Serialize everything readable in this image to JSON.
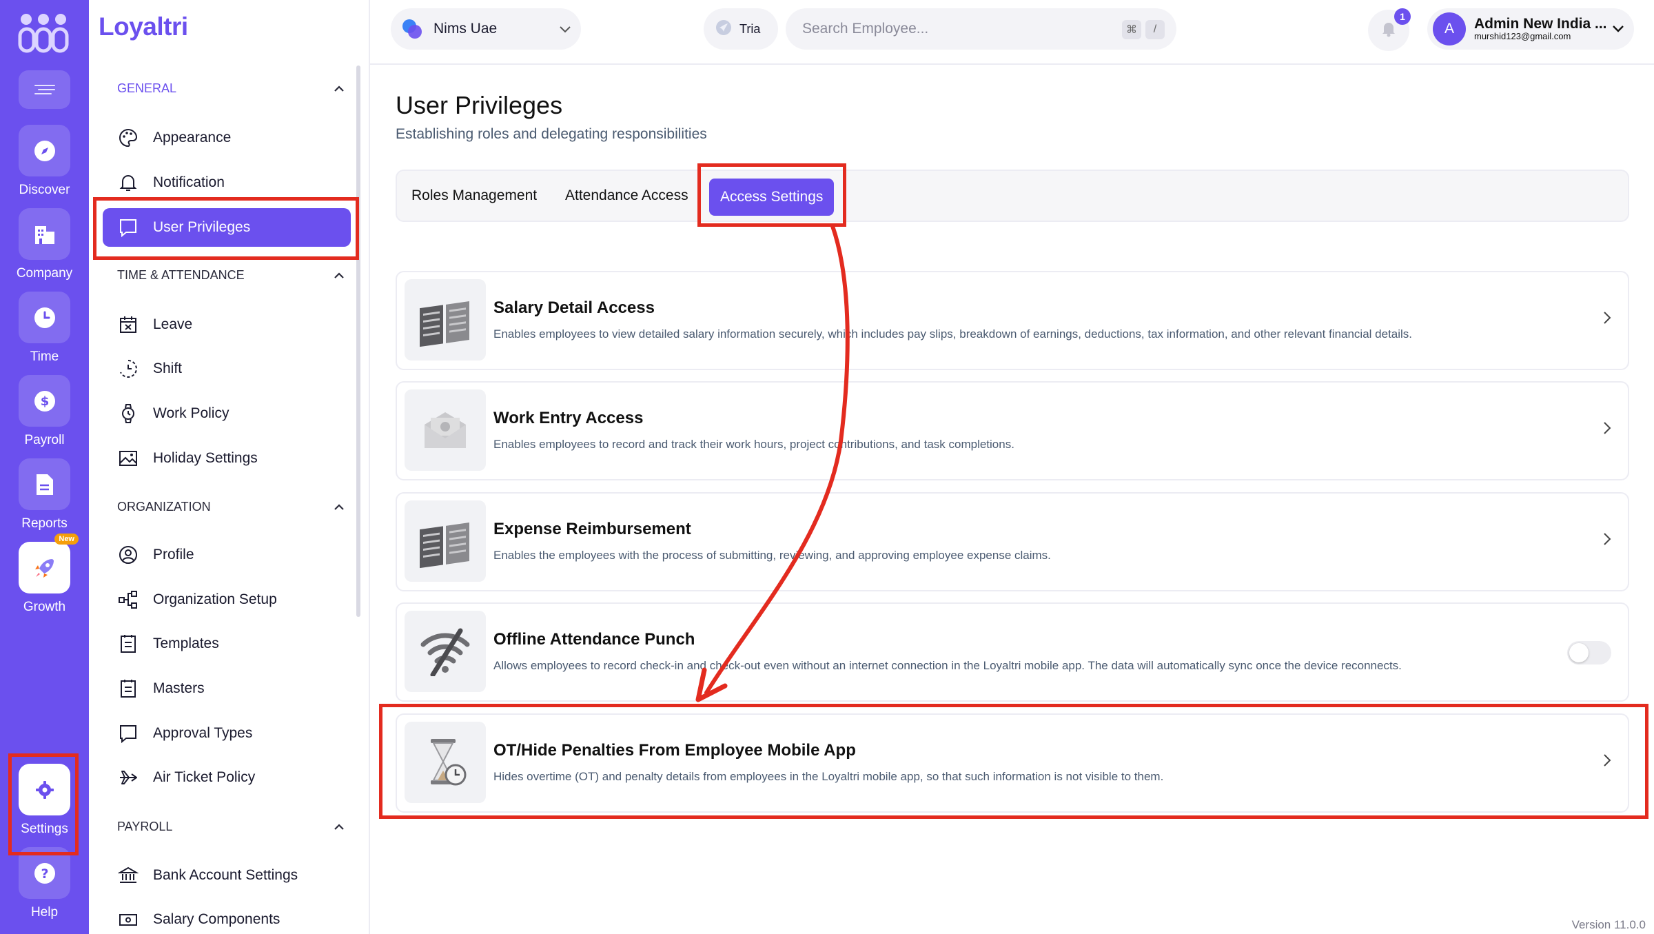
{
  "rail": {
    "items": [
      {
        "label": "Discover",
        "icon": "compass-icon"
      },
      {
        "label": "Company",
        "icon": "building-icon"
      },
      {
        "label": "Time",
        "icon": "clock-icon"
      },
      {
        "label": "Payroll",
        "icon": "dollar-icon"
      },
      {
        "label": "Reports",
        "icon": "file-icon"
      },
      {
        "label": "Growth",
        "icon": "rocket-icon",
        "badge": "New"
      },
      {
        "label": "Settings",
        "icon": "gear-icon"
      },
      {
        "label": "Help",
        "icon": "question-icon"
      }
    ]
  },
  "nav": {
    "brand": "Loyaltri",
    "sections": {
      "general": "GENERAL",
      "time": "TIME & ATTENDANCE",
      "org": "ORGANIZATION",
      "payroll": "PAYROLL"
    },
    "items": [
      "Appearance",
      "Notification",
      "User Privileges",
      "Leave",
      "Shift",
      "Work Policy",
      "Holiday Settings",
      "Profile",
      "Organization Setup",
      "Templates",
      "Masters",
      "Approval Types",
      "Air Ticket Policy",
      "Bank Account Settings",
      "Salary Components"
    ]
  },
  "header": {
    "company": "Nims Uae",
    "tria": "Tria",
    "search_placeholder": "Search Employee...",
    "kbd_1": "⌘",
    "kbd_2": "/",
    "notifications": "1",
    "user_initial": "A",
    "user_name": "Admin New India ...",
    "user_email": "murshid123@gmail.com"
  },
  "main": {
    "title": "User Privileges",
    "subtitle": "Establishing roles and delegating responsibilities",
    "tabs": [
      "Roles Management",
      "Attendance Access",
      "Access Settings"
    ],
    "active_tab": "Access Settings",
    "cards": [
      {
        "title": "Salary Detail Access",
        "desc": "Enables employees to view detailed salary information securely, which includes pay slips, breakdown of earnings, deductions, tax information, and other relevant financial details."
      },
      {
        "title": "Work Entry Access",
        "desc": "Enables employees to record and track their work hours, project contributions, and task completions."
      },
      {
        "title": "Expense Reimbursement",
        "desc": "Enables the employees with the process of submitting, reviewing, and approving employee expense claims."
      },
      {
        "title": "Offline Attendance Punch",
        "desc": "Allows employees to record check-in and check-out even without an internet connection in the Loyaltri mobile app. The data will automatically sync once the device reconnects.",
        "toggle_on": false
      },
      {
        "title": "OT/Hide Penalties From Employee Mobile App",
        "desc": "Hides overtime (OT) and penalty details from employees in the Loyaltri mobile app, so that such information is not visible to them."
      }
    ]
  },
  "footer": {
    "version": "Version 11.0.0"
  },
  "colors": {
    "accent": "#6b50ee",
    "annotation": "#e32b1f"
  }
}
